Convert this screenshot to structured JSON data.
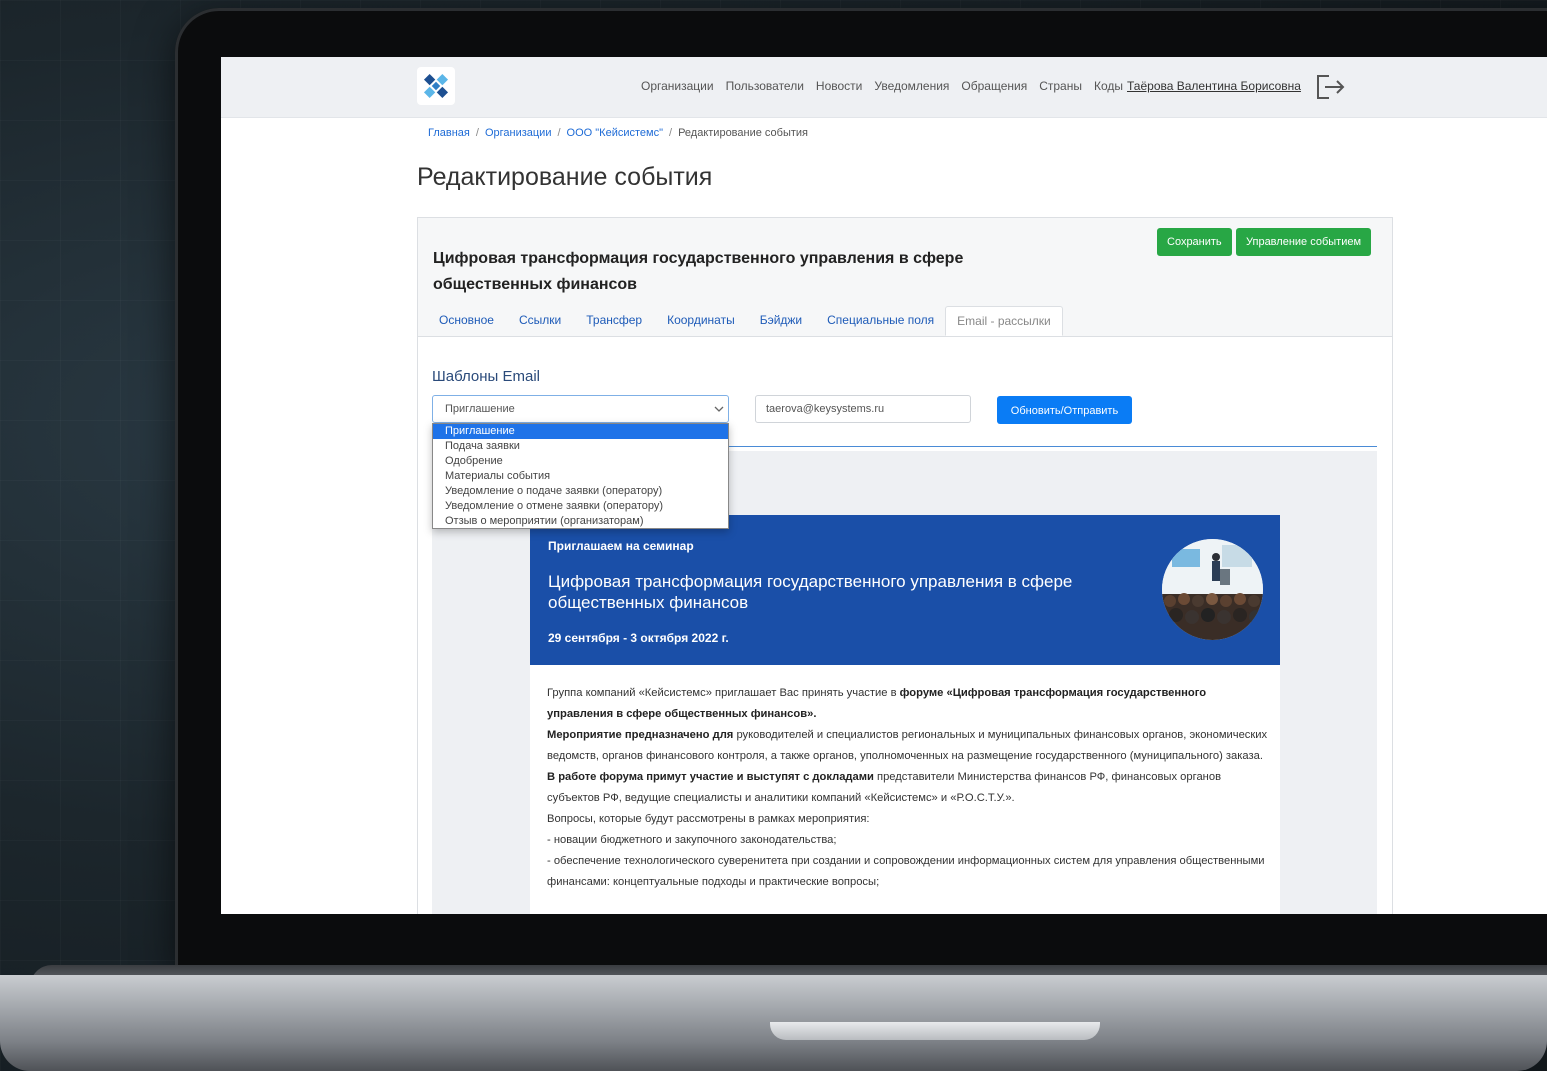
{
  "nav": {
    "links": [
      "Организации",
      "Пользователи",
      "Новости",
      "Уведомления",
      "Обращения",
      "Страны",
      "Коды"
    ],
    "user": "Таёрова Валентина Борисовна"
  },
  "breadcrumb": {
    "home": "Главная",
    "orgs": "Организации",
    "company": "ООО \"Кейсистемс\"",
    "current": "Редактирование события"
  },
  "page_title": "Редактирование события",
  "event": {
    "title": "Цифровая трансформация государственного управления в сфере общественных финансов",
    "save_label": "Сохранить",
    "manage_label": "Управление событием"
  },
  "tabs": [
    "Основное",
    "Ссылки",
    "Трансфер",
    "Координаты",
    "Бэйджи",
    "Специальные поля",
    "Email - рассылки"
  ],
  "active_tab_index": 6,
  "email_section": {
    "label": "Шаблоны Email",
    "selected_template": "Приглашение",
    "options": [
      "Приглашение",
      "Подача заявки",
      "Одобрение",
      "Материалы события",
      "Уведомление о подаче заявки (оператору)",
      "Уведомление о отмене заявки (оператору)",
      "Отзыв о мероприятии (организаторам)"
    ],
    "email_value": "taerova@keysystems.ru",
    "send_label": "Обновить/Отправить"
  },
  "preview": {
    "kicker": "Приглашаем на семинар",
    "title": "Цифровая трансформация государственного управления в сфере общественных финансов",
    "dates": "29 сентября - 3 октября 2022 г.",
    "p1_a": "Группа компаний «Кейсистемс» приглашает Вас принять участие в ",
    "p1_b": "форуме «Цифровая трансформация государственного управления в сфере общественных финансов».",
    "p2_a": "Мероприятие предназначено для",
    "p2_b": " руководителей и специалистов региональных и муниципальных финансовых органов, экономических ведомств, органов финансового контроля, а также органов, уполномоченных на размещение государственного (муниципального) заказа.",
    "p3_a": "В работе форума примут участие и выступят с докладами",
    "p3_b": " представители Министерства финансов РФ, финансовых органов субъектов РФ, ведущие специалисты и аналитики компаний «Кейсистемс» и «Р.О.С.Т.У.».",
    "p4": "Вопросы, которые будут рассмотрены в рамках мероприятия:",
    "p5": "- новации бюджетного и закупочного законодательства;",
    "p6": "- обеспечение технологического суверенитета при создании и сопровождении информационных систем для управления общественными финансами: концептуальные подходы и практические вопросы;"
  },
  "colors": {
    "primary_green": "#28a745",
    "primary_blue": "#0a7cf5",
    "banner_blue": "#1a4fa8",
    "link_blue": "#1e5bb8"
  }
}
